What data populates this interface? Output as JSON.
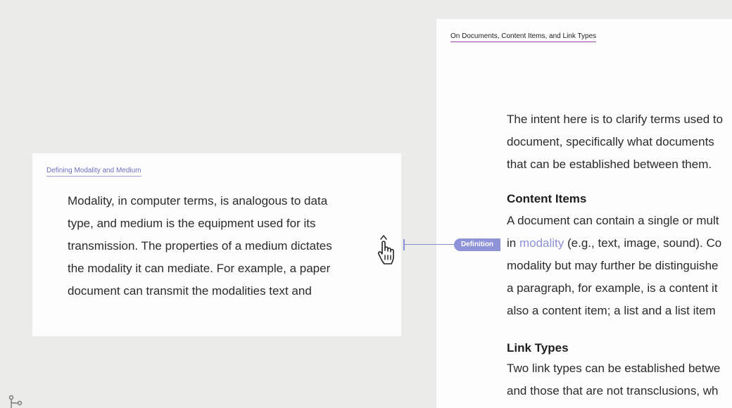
{
  "left_card": {
    "title": "Defining Modality and Medium",
    "lines": [
      "Modality, in computer terms, is analogous to data",
      "type, and medium is the equipment used for its",
      "transmission. The properties of a medium dictates",
      "the modality it can mediate. For example, a paper",
      "document can transmit the modalities text and"
    ]
  },
  "connector": {
    "label": "Definition",
    "color": "#8e92d6"
  },
  "right_card": {
    "title": "On Documents, Content Items, and Link Types",
    "intro_lines": [
      "The intent here is to clarify terms used to",
      "document, specifically what documents",
      "that can be established between them."
    ],
    "content_items": {
      "heading": "Content Items",
      "line1": "A document can contain a single or mult",
      "line2_before": "in ",
      "line2_link": "modality",
      "line2_after": " (e.g., text, image, sound). Co",
      "line3": "modality but may further be distinguishe",
      "line4": "a paragraph, for example, is a content it",
      "line5": "also a content item; a list and a list item"
    },
    "link_types": {
      "heading": "Link Types",
      "line1": "Two link types can be established betwe",
      "line2": "and those that are not transclusions, wh"
    }
  },
  "icons": {
    "cursor": "hand-pointer-icon",
    "corner": "branch-icon"
  },
  "colors": {
    "background": "#ebebe9",
    "card": "#fdfdfd",
    "accent": "#8e92d6"
  }
}
